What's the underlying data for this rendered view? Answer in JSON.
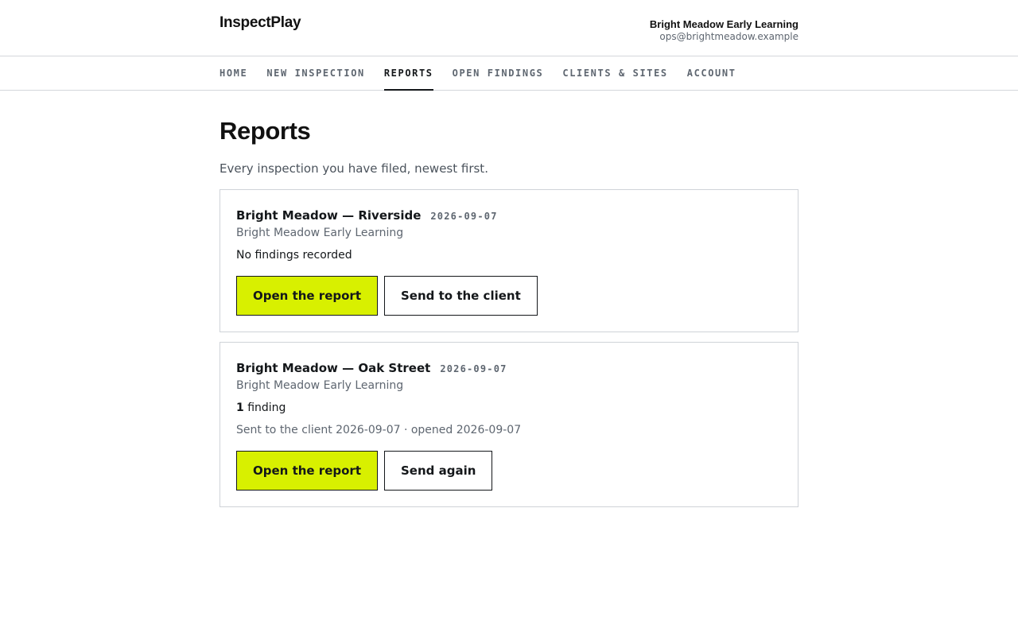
{
  "app": {
    "brand": "InspectPlay",
    "account_name": "Bright Meadow Early Learning",
    "account_email": "ops@brightmeadow.example"
  },
  "nav": {
    "items": [
      {
        "label": "HOME"
      },
      {
        "label": "NEW INSPECTION"
      },
      {
        "label": "REPORTS",
        "active": true
      },
      {
        "label": "OPEN FINDINGS"
      },
      {
        "label": "CLIENTS & SITES"
      },
      {
        "label": "ACCOUNT"
      }
    ]
  },
  "page": {
    "title": "Reports",
    "subtitle": "Every inspection you have filed, newest first."
  },
  "reports": [
    {
      "title": "Bright Meadow — Riverside",
      "date": "2026-09-07",
      "client": "Bright Meadow Early Learning",
      "findings_count": "",
      "findings_text": "No findings recorded",
      "status": "",
      "primary_action": "Open the report",
      "secondary_action": "Send to the client"
    },
    {
      "title": "Bright Meadow — Oak Street",
      "date": "2026-09-07",
      "client": "Bright Meadow Early Learning",
      "findings_count": "1",
      "findings_text": " finding",
      "status": "Sent to the client 2026-09-07 · opened 2026-09-07",
      "primary_action": "Open the report",
      "secondary_action": "Send again"
    }
  ],
  "colors": {
    "accent": "#d8f000",
    "text": "#14171a",
    "muted": "#5e6670",
    "border": "#cfd3d8"
  }
}
